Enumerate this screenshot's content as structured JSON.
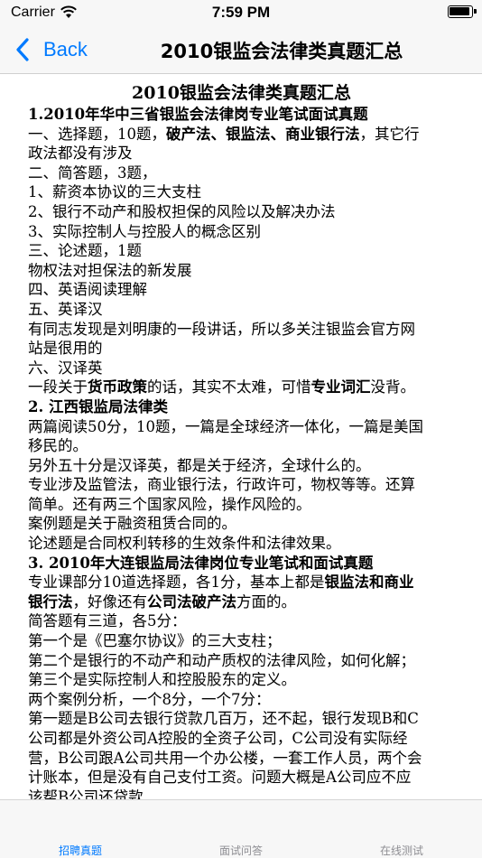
{
  "status_bar": {
    "carrier": "Carrier",
    "time": "7:59 PM"
  },
  "nav": {
    "back_label": "Back",
    "title": "2010银监会法律类真题汇总"
  },
  "article": {
    "title": "2010银监会法律类真题汇总",
    "lines": [
      {
        "t": "1.2010年华中三省银监会法律岗专业笔试面试真题",
        "bold": true
      },
      {
        "t": "一、选择题，10题，",
        "bold_part": "破产法、银监法、商业银行法",
        "t2": "，其它行"
      },
      {
        "t": "政法都没有涉及"
      },
      {
        "t": "二、简答题，3题，"
      },
      {
        "t": "1、薪资本协议的三大支柱"
      },
      {
        "t": "2、银行不动产和股权担保的风险以及解决办法"
      },
      {
        "t": "3、实际控制人与控股人的概念区别"
      },
      {
        "t": "三、论述题，1题"
      },
      {
        "t": "物权法对担保法的新发展"
      },
      {
        "t": "四、英语阅读理解"
      },
      {
        "t": "五、英译汉"
      },
      {
        "t": "有同志发现是刘明康的一段讲话，所以多关注银监会官方网"
      },
      {
        "t": "站是很用的"
      },
      {
        "t": "六、汉译英"
      },
      {
        "t": "一段关于",
        "bold_part": "货币政策",
        "t2": "的话，其实不太难，可惜",
        "bold_part2": "专业词汇",
        "t3": "没背。"
      },
      {
        "t": "2. 江西银监局法律类",
        "bold": true
      },
      {
        "t": "两篇阅读50分，10题，一篇是全球经济一体化，一篇是美国"
      },
      {
        "t": "移民的。"
      },
      {
        "t": "另外五十分是汉译英，都是关于经济，全球什么的。"
      },
      {
        "t": "专业涉及监管法，商业银行法，行政许可，物权等等。还算"
      },
      {
        "t": "简单。还有两三个国家风险，操作风险的。"
      },
      {
        "t": "案例题是关于融资租赁合同的。"
      },
      {
        "t": "论述题是合同权利转移的生效条件和法律效果。"
      },
      {
        "t": "3. 2010年大连银监局法律岗位专业笔试和面试真题",
        "bold": true
      },
      {
        "t": "专业课部分10道选择题，各1分，基本上都是",
        "bold_part": "银监法和商业"
      },
      {
        "t": "",
        "bold_part": "银行法",
        "t2": "，好像还有",
        "bold_part2": "公司法破产法",
        "t3": "方面的。"
      },
      {
        "t": "简答题有三道，各5分："
      },
      {
        "t": "第一个是《巴塞尔协议》的三大支柱；"
      },
      {
        "t": "第二个是银行的不动产和动产质权的法律风险，如何化解；"
      },
      {
        "t": "第三个是实际控制人和控股股东的定义。"
      },
      {
        "t": "两个案例分析，一个8分，一个7分："
      },
      {
        "t": "第一题是B公司去银行贷款几百万，还不起，银行发现B和C"
      },
      {
        "t": "公司都是外资公司A控股的全资子公司，C公司没有实际经"
      },
      {
        "t": "营，B公司跟A公司共用一个办公楼，一套工作人员，两个会"
      },
      {
        "t": "计账本，但是没有自己支付工资。问题大概是A公司应不应"
      },
      {
        "t": "该帮B公司还贷款"
      }
    ]
  },
  "tabs": [
    {
      "label": "招聘真题",
      "active": true
    },
    {
      "label": "面试问答",
      "active": false
    },
    {
      "label": "在线测试",
      "active": false
    }
  ],
  "colors": {
    "accent": "#007aff",
    "inactive_tab": "#8e8e93",
    "bar_background": "#f7f7f7"
  }
}
